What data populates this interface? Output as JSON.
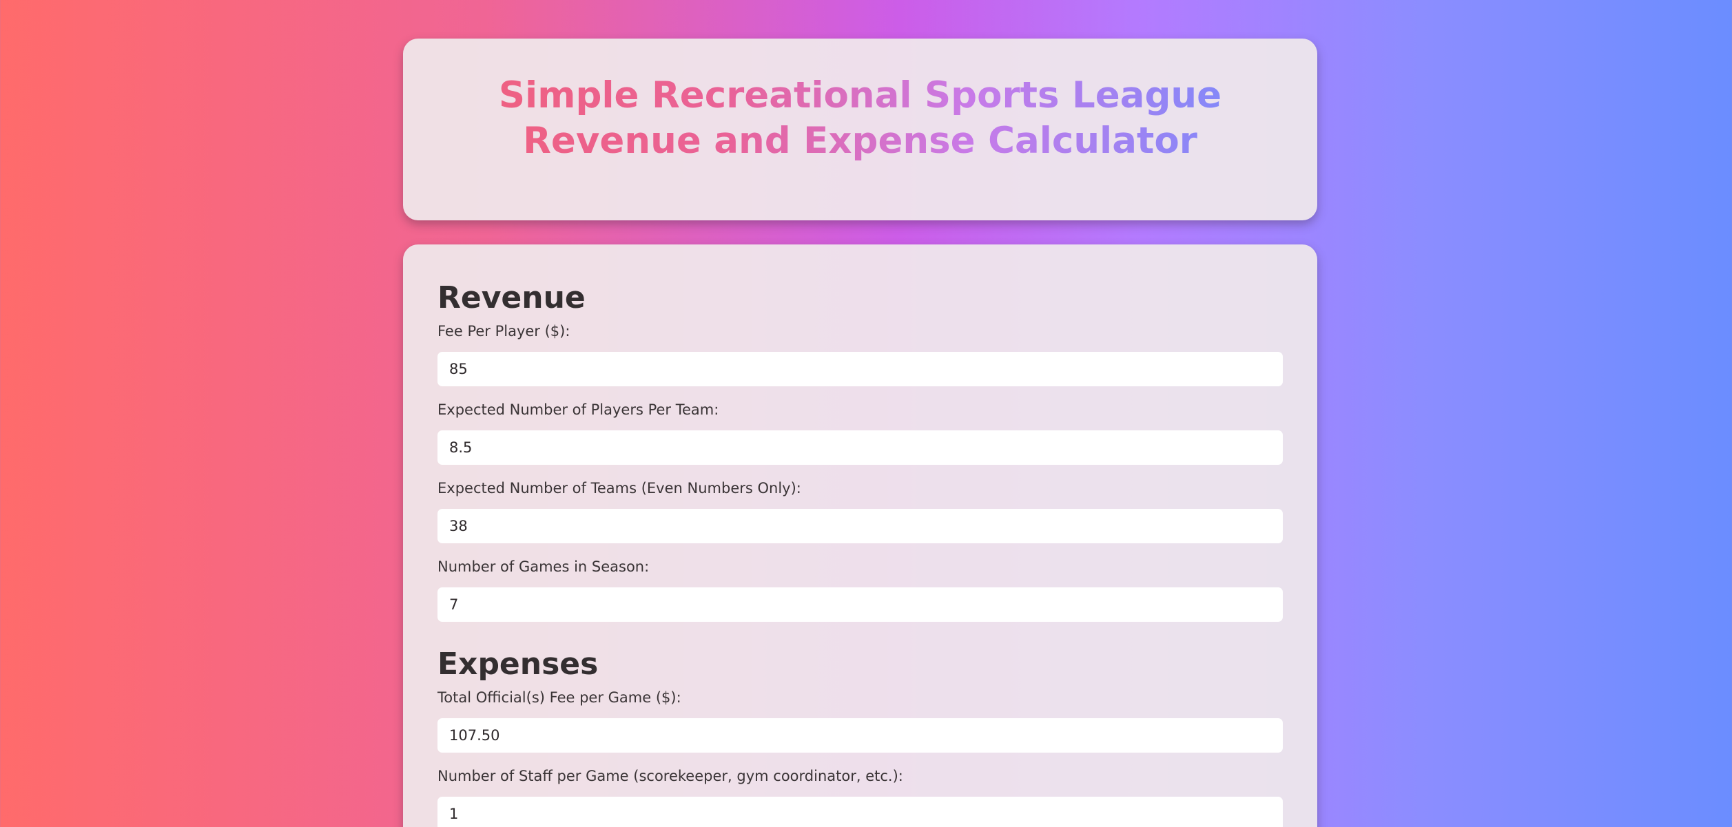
{
  "header": {
    "title": "Simple Recreational Sports League Revenue and Expense Calculator"
  },
  "revenue": {
    "heading": "Revenue",
    "fields": [
      {
        "label": "Fee Per Player ($):",
        "value": "85"
      },
      {
        "label": "Expected Number of Players Per Team:",
        "value": "8.5"
      },
      {
        "label": "Expected Number of Teams (Even Numbers Only):",
        "value": "38"
      },
      {
        "label": "Number of Games in Season:",
        "value": "7"
      }
    ]
  },
  "expenses": {
    "heading": "Expenses",
    "fields": [
      {
        "label": "Total Official(s) Fee per Game ($):",
        "value": "107.50"
      },
      {
        "label": "Number of Staff per Game (scorekeeper, gym coordinator, etc.):",
        "value": "1"
      }
    ]
  },
  "colors": {
    "background_start": "#ff6b6b",
    "background_mid": "#cc5de8",
    "background_end": "#6b8dff",
    "card_background": "#f0eaec",
    "input_background": "#ffffff"
  }
}
